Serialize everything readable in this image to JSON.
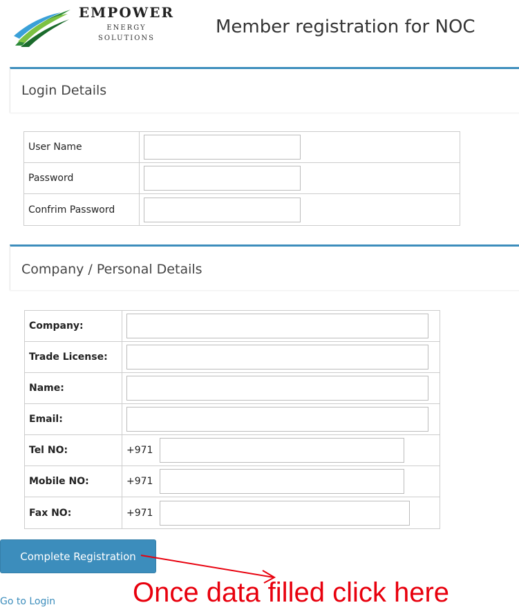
{
  "header": {
    "logo_title": "EMPOWER",
    "logo_line1": "ENERGY",
    "logo_line2": "SOLUTIONS",
    "page_title": "Member registration for NOC"
  },
  "login": {
    "heading": "Login Details",
    "fields": [
      {
        "label": "User Name",
        "value": ""
      },
      {
        "label": "Password",
        "value": ""
      },
      {
        "label": "Confrim Password",
        "value": ""
      }
    ]
  },
  "company": {
    "heading": "Company / Personal Details",
    "fields": [
      {
        "label": "Company:",
        "value": ""
      },
      {
        "label": "Trade License:",
        "value": ""
      },
      {
        "label": "Name:",
        "value": ""
      },
      {
        "label": "Email:",
        "value": ""
      }
    ],
    "phones": [
      {
        "label": "Tel NO:",
        "prefix": "+971",
        "value": ""
      },
      {
        "label": "Mobile NO:",
        "prefix": "+971",
        "value": ""
      },
      {
        "label": "Fax NO:",
        "prefix": "+971",
        "value": ""
      }
    ]
  },
  "actions": {
    "submit_label": "Complete Registration",
    "login_link": "Go to Login"
  },
  "annotation": {
    "text": "Once data filled click here",
    "color": "#e8000d"
  },
  "colors": {
    "accent": "#3c8dbc"
  }
}
